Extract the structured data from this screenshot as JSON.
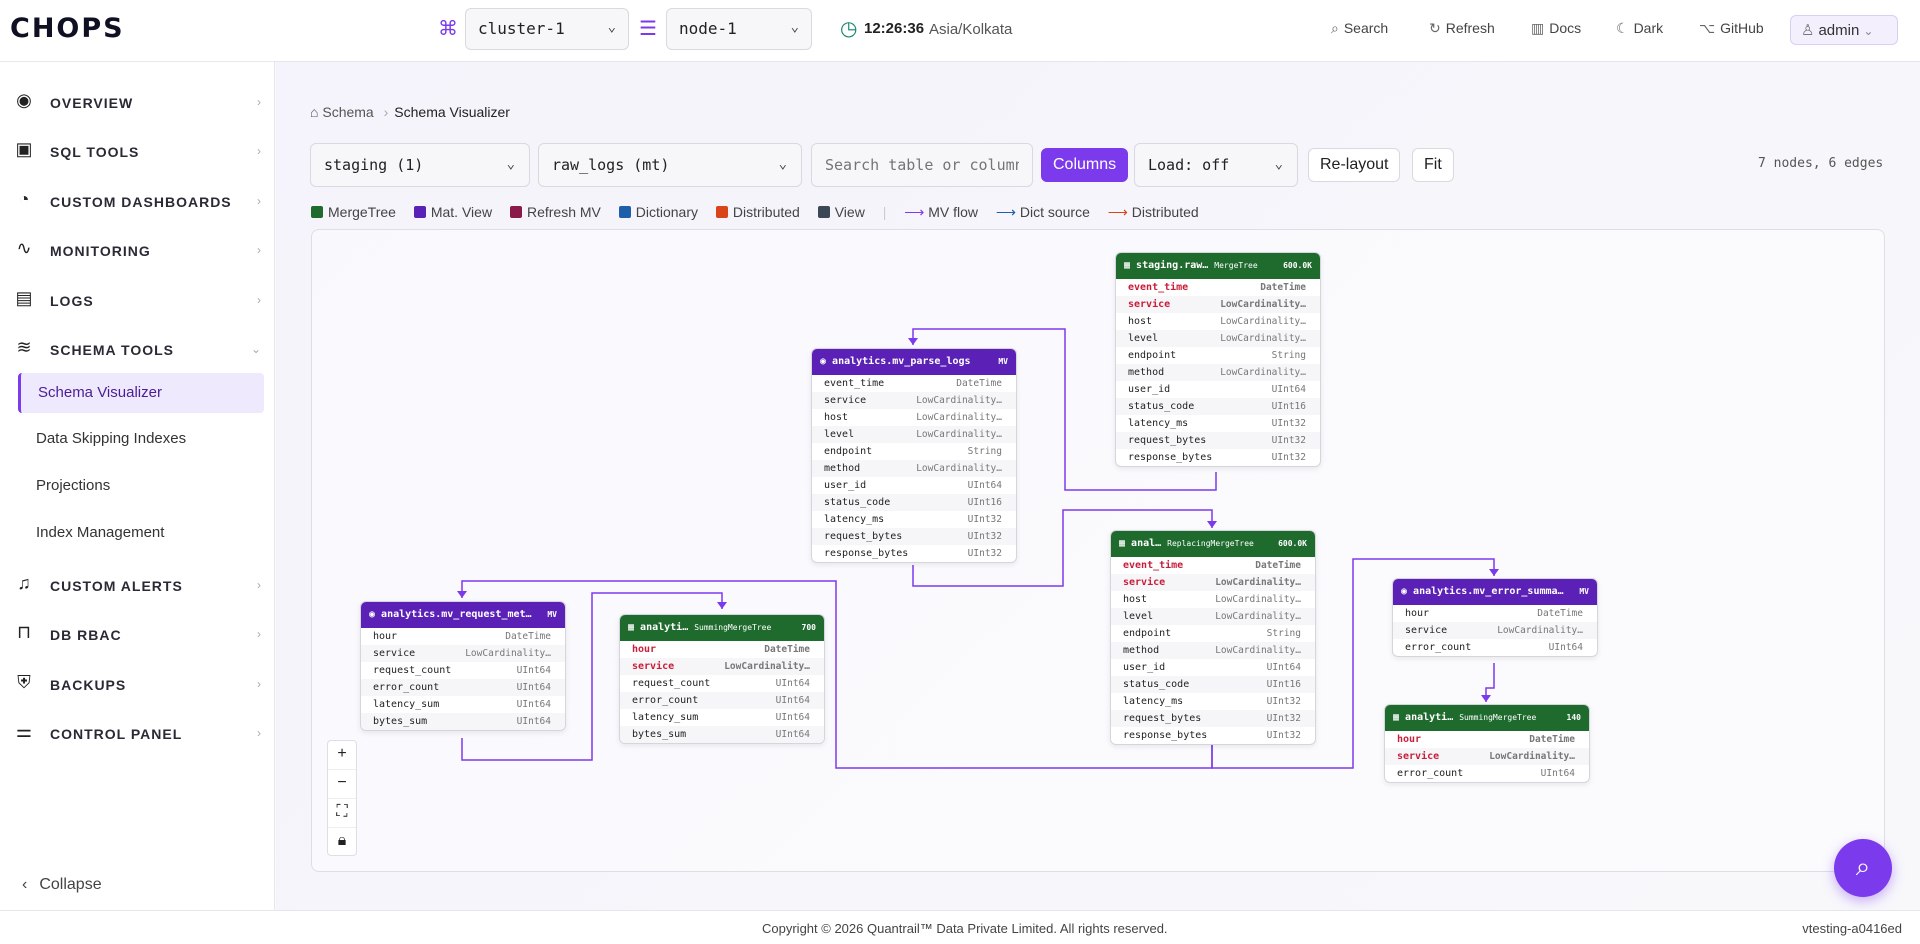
{
  "header": {
    "logo": "CHOPS",
    "cluster": "cluster-1",
    "node": "node-1",
    "time": "12:26:36",
    "tz": "Asia/Kolkata",
    "search": "Search",
    "refresh": "Refresh",
    "docs": "Docs",
    "dark": "Dark",
    "github": "GitHub",
    "user": "admin"
  },
  "sidebar": {
    "items": [
      {
        "label": "OVERVIEW",
        "icon": "eye-icon"
      },
      {
        "label": "SQL TOOLS",
        "icon": "terminal-icon"
      },
      {
        "label": "CUSTOM DASHBOARDS",
        "icon": "pie-chart-icon"
      },
      {
        "label": "MONITORING",
        "icon": "activity-icon"
      },
      {
        "label": "LOGS",
        "icon": "file-icon"
      },
      {
        "label": "SCHEMA TOOLS",
        "icon": "database-icon"
      },
      {
        "label": "CUSTOM ALERTS",
        "icon": "bell-icon"
      },
      {
        "label": "DB RBAC",
        "icon": "lock-icon"
      },
      {
        "label": "BACKUPS",
        "icon": "shield-icon"
      },
      {
        "label": "CONTROL PANEL",
        "icon": "sliders-icon"
      }
    ],
    "schema_sub": [
      "Schema Visualizer",
      "Data Skipping Indexes",
      "Projections",
      "Index Management"
    ],
    "collapse": "Collapse"
  },
  "breadcrumb": {
    "root": "Schema",
    "current": "Schema Visualizer"
  },
  "toolbar": {
    "database": "staging (1)",
    "table": "raw_logs (mt)",
    "search_placeholder": "Search table or column",
    "columns": "Columns",
    "load": "Load: off",
    "relayout": "Re-layout",
    "fit": "Fit",
    "summary": "7 nodes, 6 edges"
  },
  "legend": [
    {
      "label": "MergeTree",
      "color": "#1f6b2e"
    },
    {
      "label": "Mat. View",
      "color": "#5b21b6"
    },
    {
      "label": "Refresh MV",
      "color": "#8b1a4a"
    },
    {
      "label": "Dictionary",
      "color": "#1d5fa8"
    },
    {
      "label": "Distributed",
      "color": "#d9441a"
    },
    {
      "label": "View",
      "color": "#3d4856"
    }
  ],
  "legend_edges": [
    {
      "label": "MV flow",
      "color": "#7c3aed"
    },
    {
      "label": "Dict source",
      "color": "#1d5fa8"
    },
    {
      "label": "Distributed",
      "color": "#d9441a"
    }
  ],
  "nodes": [
    {
      "title": "staging.raw…",
      "engine": "MergeTree",
      "count": "600.0K",
      "color": "#1f6b2e",
      "rows": [
        [
          "event_time",
          "DateTime",
          1
        ],
        [
          "service",
          "LowCardinality…",
          1
        ],
        [
          "host",
          "LowCardinality…",
          0
        ],
        [
          "level",
          "LowCardinality…",
          0
        ],
        [
          "endpoint",
          "String",
          0
        ],
        [
          "method",
          "LowCardinality…",
          0
        ],
        [
          "user_id",
          "UInt64",
          0
        ],
        [
          "status_code",
          "UInt16",
          0
        ],
        [
          "latency_ms",
          "UInt32",
          0
        ],
        [
          "request_bytes",
          "UInt32",
          0
        ],
        [
          "response_bytes",
          "UInt32",
          0
        ]
      ]
    },
    {
      "title": "analytics.mv_parse_logs",
      "engine": "",
      "count": "MV",
      "color": "#5b21b6",
      "rows": [
        [
          "event_time",
          "DateTime",
          0
        ],
        [
          "service",
          "LowCardinality…",
          0
        ],
        [
          "host",
          "LowCardinality…",
          0
        ],
        [
          "level",
          "LowCardinality…",
          0
        ],
        [
          "endpoint",
          "String",
          0
        ],
        [
          "method",
          "LowCardinality…",
          0
        ],
        [
          "user_id",
          "UInt64",
          0
        ],
        [
          "status_code",
          "UInt16",
          0
        ],
        [
          "latency_ms",
          "UInt32",
          0
        ],
        [
          "request_bytes",
          "UInt32",
          0
        ],
        [
          "response_bytes",
          "UInt32",
          0
        ]
      ]
    },
    {
      "title": "anal…",
      "engine": "ReplacingMergeTree",
      "count": "600.0K",
      "color": "#1f6b2e",
      "rows": [
        [
          "event_time",
          "DateTime",
          1
        ],
        [
          "service",
          "LowCardinality…",
          1
        ],
        [
          "host",
          "LowCardinality…",
          0
        ],
        [
          "level",
          "LowCardinality…",
          0
        ],
        [
          "endpoint",
          "String",
          0
        ],
        [
          "method",
          "LowCardinality…",
          0
        ],
        [
          "user_id",
          "UInt64",
          0
        ],
        [
          "status_code",
          "UInt16",
          0
        ],
        [
          "latency_ms",
          "UInt32",
          0
        ],
        [
          "request_bytes",
          "UInt32",
          0
        ],
        [
          "response_bytes",
          "UInt32",
          0
        ]
      ]
    },
    {
      "title": "analytics.mv_request_met…",
      "engine": "",
      "count": "MV",
      "color": "#5b21b6",
      "rows": [
        [
          "hour",
          "DateTime",
          0
        ],
        [
          "service",
          "LowCardinality…",
          0
        ],
        [
          "request_count",
          "UInt64",
          0
        ],
        [
          "error_count",
          "UInt64",
          0
        ],
        [
          "latency_sum",
          "UInt64",
          0
        ],
        [
          "bytes_sum",
          "UInt64",
          0
        ]
      ]
    },
    {
      "title": "analyti…",
      "engine": "SummingMergeTree",
      "count": "700",
      "color": "#1f6b2e",
      "rows": [
        [
          "hour",
          "DateTime",
          1
        ],
        [
          "service",
          "LowCardinality…",
          1
        ],
        [
          "request_count",
          "UInt64",
          0
        ],
        [
          "error_count",
          "UInt64",
          0
        ],
        [
          "latency_sum",
          "UInt64",
          0
        ],
        [
          "bytes_sum",
          "UInt64",
          0
        ]
      ]
    },
    {
      "title": "analytics.mv_error_summa…",
      "engine": "",
      "count": "MV",
      "color": "#5b21b6",
      "rows": [
        [
          "hour",
          "DateTime",
          0
        ],
        [
          "service",
          "LowCardinality…",
          0
        ],
        [
          "error_count",
          "UInt64",
          0
        ]
      ]
    },
    {
      "title": "analyti…",
      "engine": "SummingMergeTree",
      "count": "140",
      "color": "#1f6b2e",
      "rows": [
        [
          "hour",
          "DateTime",
          1
        ],
        [
          "service",
          "LowCardinality…",
          1
        ],
        [
          "error_count",
          "UInt64",
          0
        ]
      ]
    }
  ],
  "footer": {
    "copyright": "Copyright © 2026 Quantrail™ Data Private Limited. All rights reserved.",
    "version": "vtesting-a0416ed"
  }
}
